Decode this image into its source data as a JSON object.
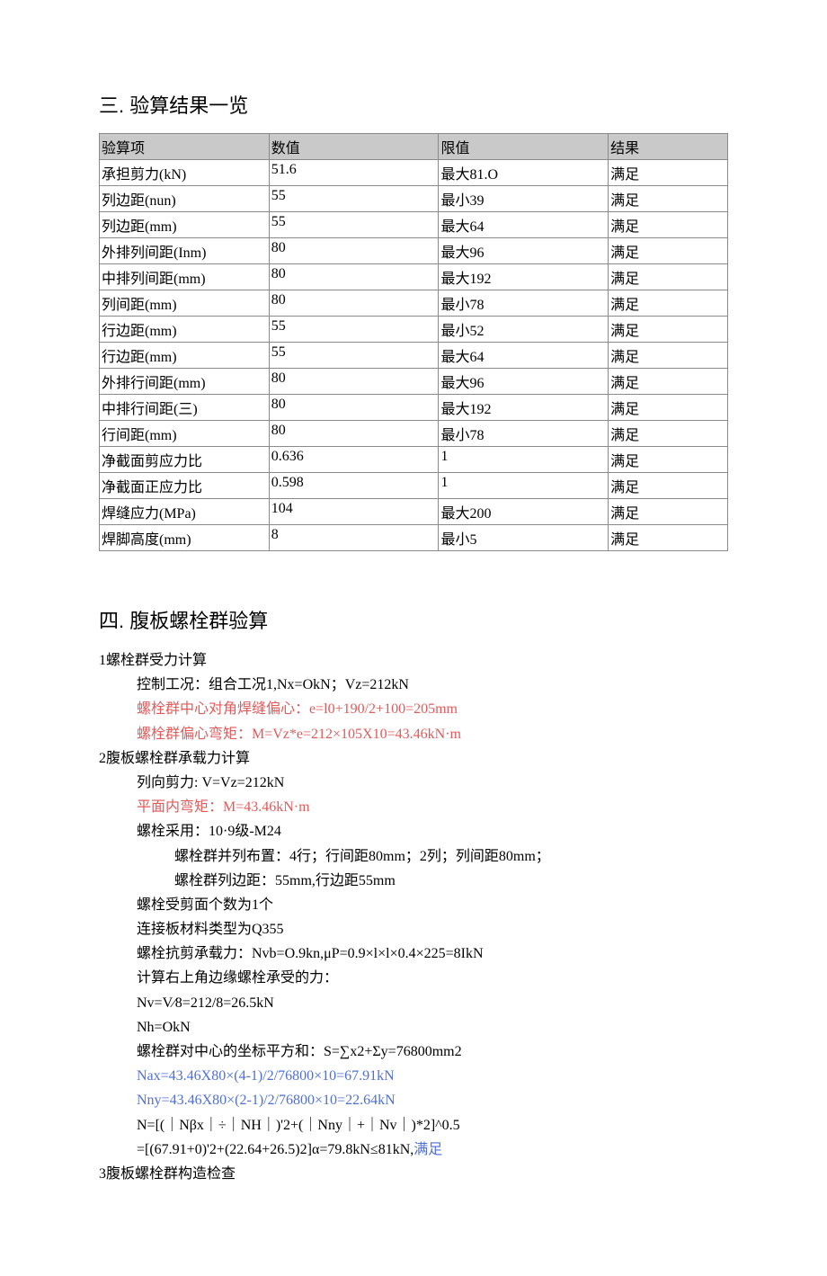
{
  "section3": {
    "title": "三. 验算结果一览",
    "headers": [
      "验算项",
      "数值",
      "限值",
      "结果"
    ],
    "rows": [
      {
        "c0": "承担剪力(kN)",
        "c1": "51.6",
        "c2": "最大81.O",
        "c3": "满足",
        "dotted": false
      },
      {
        "c0": "列边距(nun)",
        "c1": "55",
        "c2": "最小39",
        "c3": "满足",
        "dotted": false
      },
      {
        "c0": "列边距(mm)",
        "c1": "55",
        "c2": "最大64",
        "c3": "满足",
        "dotted": true
      },
      {
        "c0": "外排列间距(Inm)",
        "c1": "80",
        "c2": "最大96",
        "c3": "满足",
        "dotted": false
      },
      {
        "c0": "中排列间距(mm)",
        "c1": "80",
        "c2": "最大192",
        "c3": "满足",
        "dotted": false
      },
      {
        "c0": "列间距(mm)",
        "c1": "80",
        "c2": "最小78",
        "c3": "满足",
        "dotted": true
      },
      {
        "c0": "行边距(mm)",
        "c1": "55",
        "c2": "最小52",
        "c3": "满足",
        "dotted": true
      },
      {
        "c0": "行边距(mm)",
        "c1": "55",
        "c2": "最大64",
        "c3": "满足",
        "dotted": false
      },
      {
        "c0": "外排行间距(mm)",
        "c1": "80",
        "c2": "最大96",
        "c3": "满足",
        "dotted": true
      },
      {
        "c0": "中排行间距(三)",
        "c1": "80",
        "c2": "最大192",
        "c3": "满足",
        "dotted": false
      },
      {
        "c0": "行间距(mm)",
        "c1": "80",
        "c2": "最小78",
        "c3": "满足",
        "dotted": false
      },
      {
        "c0": "净截面剪应力比",
        "c1": "0.636",
        "c2": "1",
        "c3": "满足",
        "dotted": true
      },
      {
        "c0": "净截面正应力比",
        "c1": "0.598",
        "c2": "1",
        "c3": "满足",
        "dotted": true
      },
      {
        "c0": "焊缝应力(MPa)",
        "c1": "104",
        "c2": "最大200",
        "c3": "满足",
        "dotted": false
      },
      {
        "c0": "焊脚高度(mm)",
        "c1": "8",
        "c2": "最小5",
        "c3": "满足",
        "dotted": false
      }
    ]
  },
  "section4": {
    "title": "四. 腹板螺栓群验算",
    "lines": [
      {
        "lvl": "lvl0",
        "cls": "",
        "txt": "1螺栓群受力计算"
      },
      {
        "lvl": "lvl1",
        "cls": "",
        "txt": "控制工况：组合工况1,Nx=OkN；Vz=212kN"
      },
      {
        "lvl": "lvl1",
        "cls": "red",
        "txt": "螺栓群中心对角焊缝偏心：e=l0+190/2+100=205mm"
      },
      {
        "lvl": "lvl1",
        "cls": "red",
        "txt": "螺栓群偏心弯矩：M=Vz*e=212×105X10=43.46kN·m"
      },
      {
        "lvl": "lvl0",
        "cls": "",
        "txt": "2腹板螺栓群承载力计算"
      },
      {
        "lvl": "lvl1",
        "cls": "",
        "txt": "列向剪力: V=Vz=212kN"
      },
      {
        "lvl": "lvl1",
        "cls": "red",
        "txt": "平面内弯矩：M=43.46kN·m"
      },
      {
        "lvl": "lvl1",
        "cls": "",
        "txt": "螺栓采用：10·9级-M24"
      },
      {
        "lvl": "lvl2",
        "cls": "",
        "txt": "螺栓群并列布置：4行；行间距80mm；2列；列间距80mm；"
      },
      {
        "lvl": "lvl2",
        "cls": "",
        "txt": "螺栓群列边距：55mm,行边距55mm"
      },
      {
        "lvl": "lvl1",
        "cls": "",
        "txt": "螺栓受剪面个数为1个"
      },
      {
        "lvl": "lvl1",
        "cls": "",
        "txt": "连接板材料类型为Q355"
      },
      {
        "lvl": "lvl1",
        "cls": "",
        "txt": "螺栓抗剪承载力：Nvb=O.9kn,μP=0.9×l×l×0.4×225=8IkN"
      },
      {
        "lvl": "lvl1",
        "cls": "",
        "txt": "计算右上角边缘螺栓承受的力："
      },
      {
        "lvl": "lvl1",
        "cls": "",
        "txt": "Nv=V⁄8=212/8=26.5kN"
      },
      {
        "lvl": "lvl1",
        "cls": "",
        "txt": "Nh=OkN",
        "sub": "h"
      },
      {
        "lvl": "lvl1",
        "cls": "",
        "txt": "螺栓群对中心的坐标平方和：S=∑x2+Σy=76800mm2"
      },
      {
        "lvl": "lvl1",
        "cls": "blue",
        "txt": "Nax=43.46X80×(4-1)/2/76800×10=67.91kN"
      },
      {
        "lvl": "lvl1",
        "cls": "blue",
        "txt": "Nny=43.46X80×(2-1)/2/76800×10=22.64kN"
      },
      {
        "lvl": "lvl1",
        "cls": "",
        "txt": "N=[(｜Nβx｜÷｜NH｜)'2+(｜Nny｜+｜Nv｜)*2]^0.5"
      },
      {
        "lvl": "lvl1",
        "cls": "",
        "txt": "  =[(67.91+0)'2+(22.64+26.5)2]α=79.8kN≤81kN,",
        "tail": "满足",
        "tailcls": "blue"
      },
      {
        "lvl": "lvl0",
        "cls": "",
        "txt": "3腹板螺栓群构造检查"
      }
    ]
  }
}
